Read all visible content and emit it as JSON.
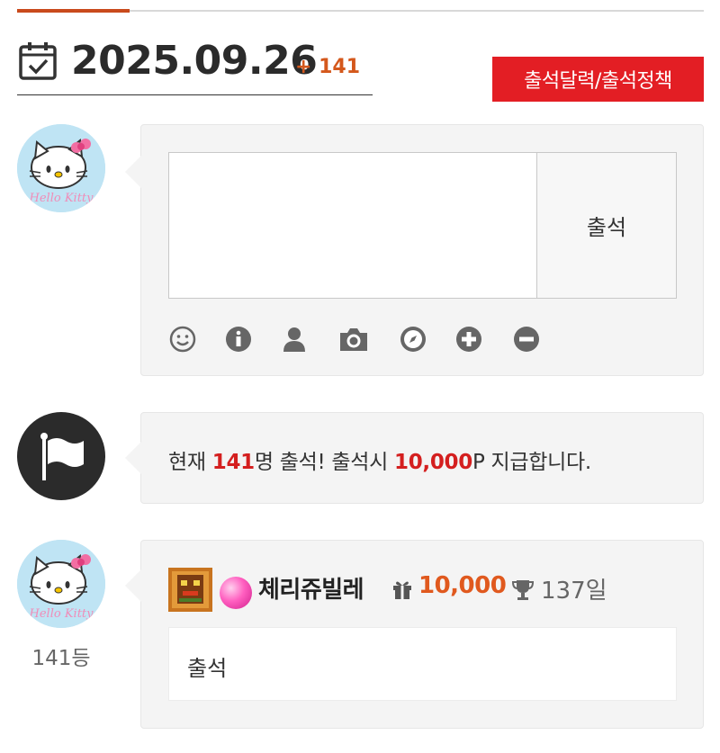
{
  "header": {
    "date": "2025.09.26",
    "count": "+ 141",
    "policy_button": "출석달력/출석정책"
  },
  "input_form": {
    "submit_label": "출석",
    "toolbar_icons": [
      "smile-icon",
      "info-icon",
      "user-icon",
      "camera-icon",
      "compass-icon",
      "plus-circle-icon",
      "minus-circle-icon"
    ]
  },
  "notice": {
    "prefix": "현재 ",
    "count": "141",
    "middle": "명 출석! 출석시 ",
    "points": "10,000",
    "suffix": "P 지급합니다."
  },
  "entry": {
    "rank": "141등",
    "nickname": "체리쥬빌레",
    "points": "10,000",
    "days": "137일",
    "message": "출석"
  },
  "colors": {
    "accent": "#e31e24",
    "points_orange": "#e0591e",
    "highlight_red": "#d41f1f",
    "card_bg": "#f4f4f4"
  }
}
